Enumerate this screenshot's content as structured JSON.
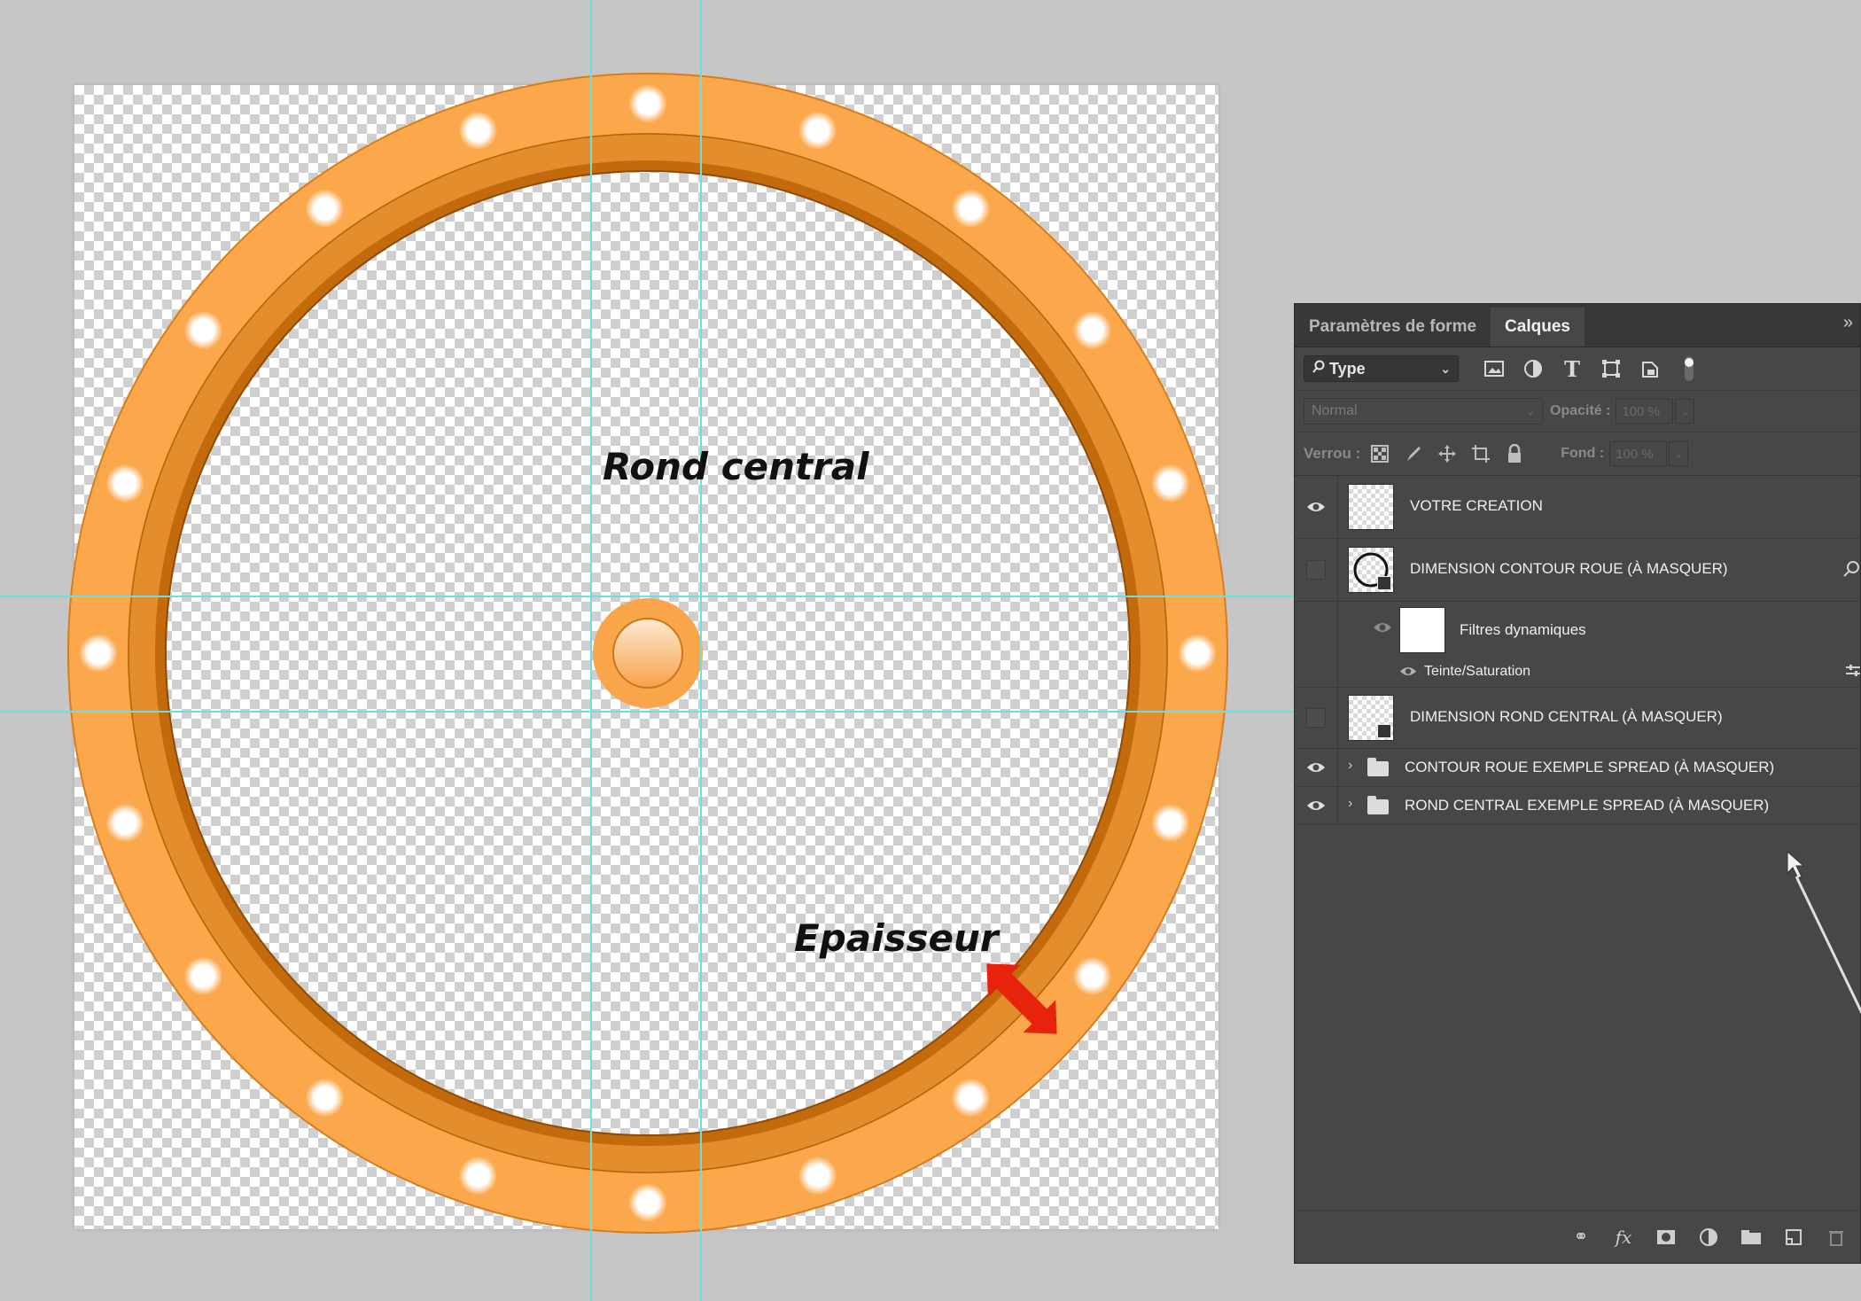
{
  "canvas": {
    "annotations": {
      "center_label": "Rond central",
      "thickness_label": "Epaisseur"
    },
    "colors": {
      "wheel_orange": "#fba74b",
      "wheel_dark": "#c26a0c",
      "hub_orange": "#f9a54a",
      "guide_cyan": "#6fdede",
      "arrow_red": "#e8230d"
    },
    "bulb_count": 20
  },
  "layers_panel": {
    "tabs": [
      {
        "label": "Paramètres de forme",
        "active": false
      },
      {
        "label": "Calques",
        "active": true
      }
    ],
    "collapse_icon": "double-chevron-icon",
    "filter": {
      "type_label": "Type",
      "icons": [
        "image-filter-icon",
        "adjustment-filter-icon",
        "text-filter-icon",
        "shape-filter-icon",
        "smart-object-filter-icon",
        "filter-toggle-icon"
      ]
    },
    "blend": {
      "mode": "Normal",
      "opacity_label": "Opacité :",
      "opacity_value": "100 %"
    },
    "lock": {
      "label": "Verrou :",
      "icons": [
        "lock-transparency-icon",
        "lock-pixels-icon",
        "lock-position-icon",
        "lock-artboard-icon",
        "lock-all-icon"
      ],
      "fill_label": "Fond :",
      "fill_value": "100 %"
    },
    "layers": [
      {
        "name": "VOTRE CREATION",
        "visible": true,
        "kind": "pixel"
      },
      {
        "name": "DIMENSION CONTOUR ROUE (À MASQUER)",
        "visible": false,
        "kind": "smart"
      },
      {
        "name": "Filtres dynamiques",
        "visible": true,
        "kind": "filter"
      },
      {
        "name": "Teinte/Saturation",
        "visible": true,
        "kind": "adjust"
      },
      {
        "name": "DIMENSION ROND CENTRAL (À MASQUER)",
        "visible": false,
        "kind": "smart"
      },
      {
        "name": "CONTOUR ROUE EXEMPLE SPREAD (À MASQUER)",
        "visible": true,
        "kind": "group"
      },
      {
        "name": "ROND CENTRAL EXEMPLE SPREAD (À MASQUER)",
        "visible": true,
        "kind": "group"
      }
    ],
    "footer_icons": [
      "link-layers-icon",
      "fx-icon",
      "add-mask-icon",
      "new-adjustment-icon",
      "new-group-icon",
      "new-layer-icon",
      "delete-layer-icon"
    ]
  }
}
